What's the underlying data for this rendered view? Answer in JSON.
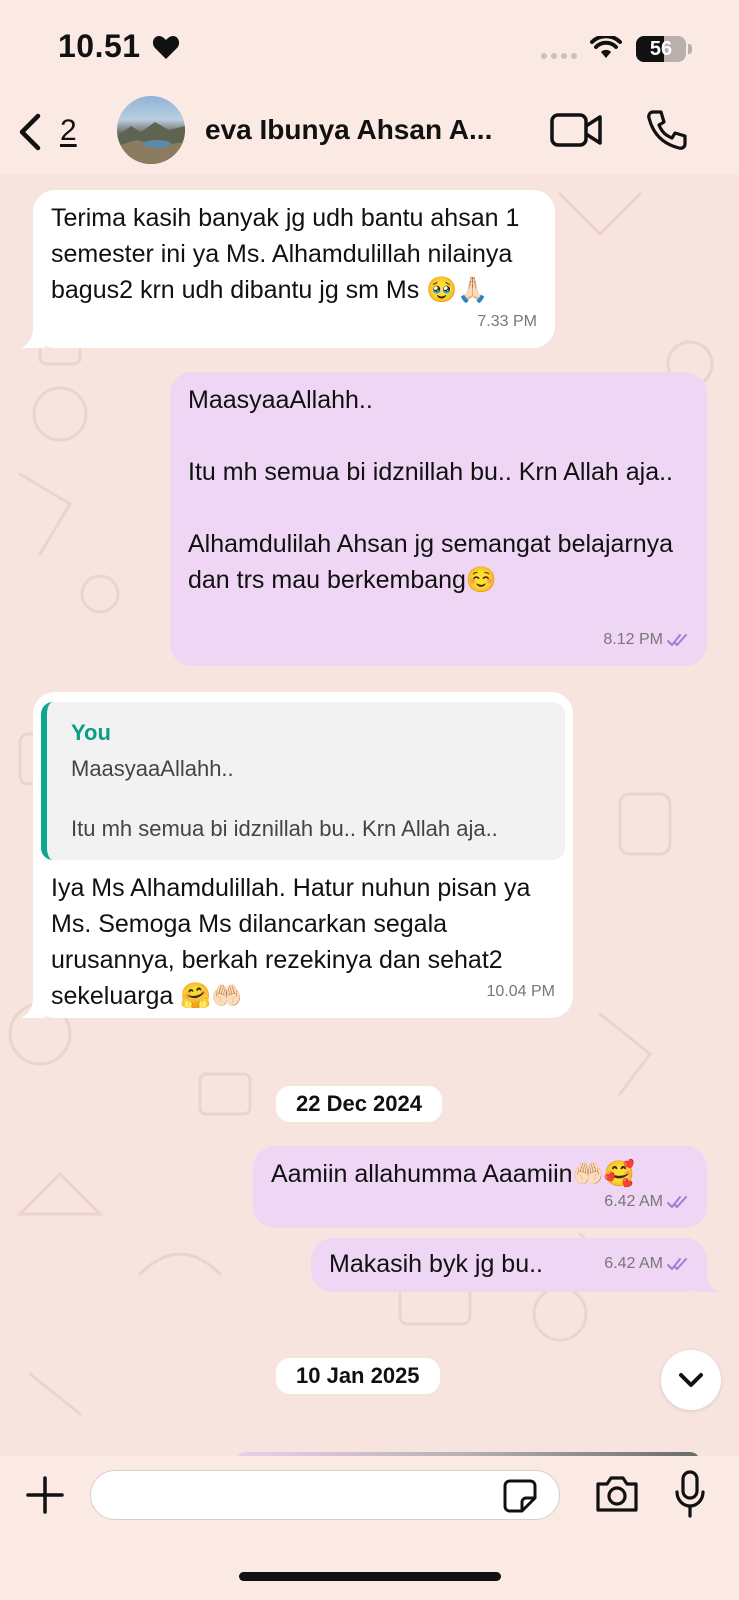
{
  "status_bar": {
    "time": "10.51",
    "battery_level": "56",
    "battery_fraction": 0.56
  },
  "header": {
    "back_count": "2",
    "contact_name": "eva Ibunya Ahsan A..."
  },
  "messages": [
    {
      "direction": "incoming",
      "text": "Terima kasih banyak jg udh bantu ahsan 1 semester ini ya Ms. Alhamdulillah nilainya bagus2 krn udh dibantu jg sm Ms 🥹🙏🏻",
      "time": "7.33 PM"
    },
    {
      "direction": "outgoing",
      "text": "MaasyaaAllahh..\n\nItu mh semua bi idznillah bu.. Krn Allah aja..\n\nAlhamdulilah Ahsan jg semangat belajarnya dan trs mau berkembang☺️",
      "time": "8.12 PM",
      "status": "read"
    },
    {
      "direction": "incoming",
      "quote": {
        "author": "You",
        "text": "MaasyaaAllahh..\n\nItu mh semua bi idznillah bu.. Krn Allah aja.."
      },
      "text": "Iya Ms Alhamdulillah. Hatur nuhun pisan ya Ms. Semoga Ms dilancarkan segala urusannya, berkah rezekinya dan sehat2 sekeluarga 🤗🤲🏻",
      "time": "10.04 PM"
    },
    {
      "direction": "outgoing",
      "text": "Aamiin allahumma Aaamiin🤲🏻🥰",
      "time": "6.42 AM",
      "status": "read"
    },
    {
      "direction": "outgoing",
      "text": "Makasih byk jg bu..",
      "time": "6.42 AM",
      "status": "read"
    }
  ],
  "date_separators": [
    "22 Dec 2024",
    "10 Jan 2025"
  ],
  "composer": {
    "value": "",
    "placeholder": ""
  },
  "icons": {
    "back": "chevron-left-icon",
    "video": "video-camera-icon",
    "call": "phone-icon",
    "scroll": "chevron-down-icon",
    "attach": "plus-icon",
    "sticker": "sticker-icon",
    "camera": "camera-icon",
    "mic": "microphone-icon"
  },
  "colors": {
    "background": "#f7e4df",
    "incoming_bubble": "#ffffff",
    "outgoing_bubble": "#eed6f4",
    "quote_accent": "#0ea68f",
    "read_ticks": "#9b7fd6"
  }
}
